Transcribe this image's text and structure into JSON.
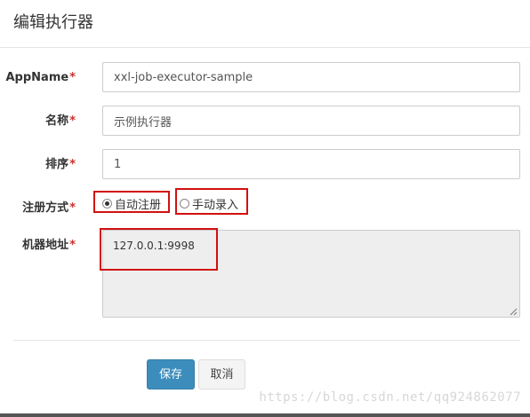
{
  "header": {
    "title": "编辑执行器"
  },
  "form": {
    "required_mark": "*",
    "appname": {
      "label": "AppName",
      "value": "xxl-job-executor-sample"
    },
    "name": {
      "label": "名称",
      "value": "示例执行器"
    },
    "order": {
      "label": "排序",
      "value": "1"
    },
    "register_type": {
      "label": "注册方式",
      "options": [
        {
          "label": "自动注册",
          "checked": true
        },
        {
          "label": "手动录入",
          "checked": false
        }
      ]
    },
    "address": {
      "label": "机器地址",
      "value": "127.0.0.1:9998"
    }
  },
  "buttons": {
    "save": "保存",
    "cancel": "取消"
  },
  "watermark": "https://blog.csdn.net/qq924862077",
  "colors": {
    "primary": "#3c8dbc",
    "required": "#c9302c",
    "highlight_box": "#d21010",
    "readonly_bg": "#eeeeee"
  }
}
